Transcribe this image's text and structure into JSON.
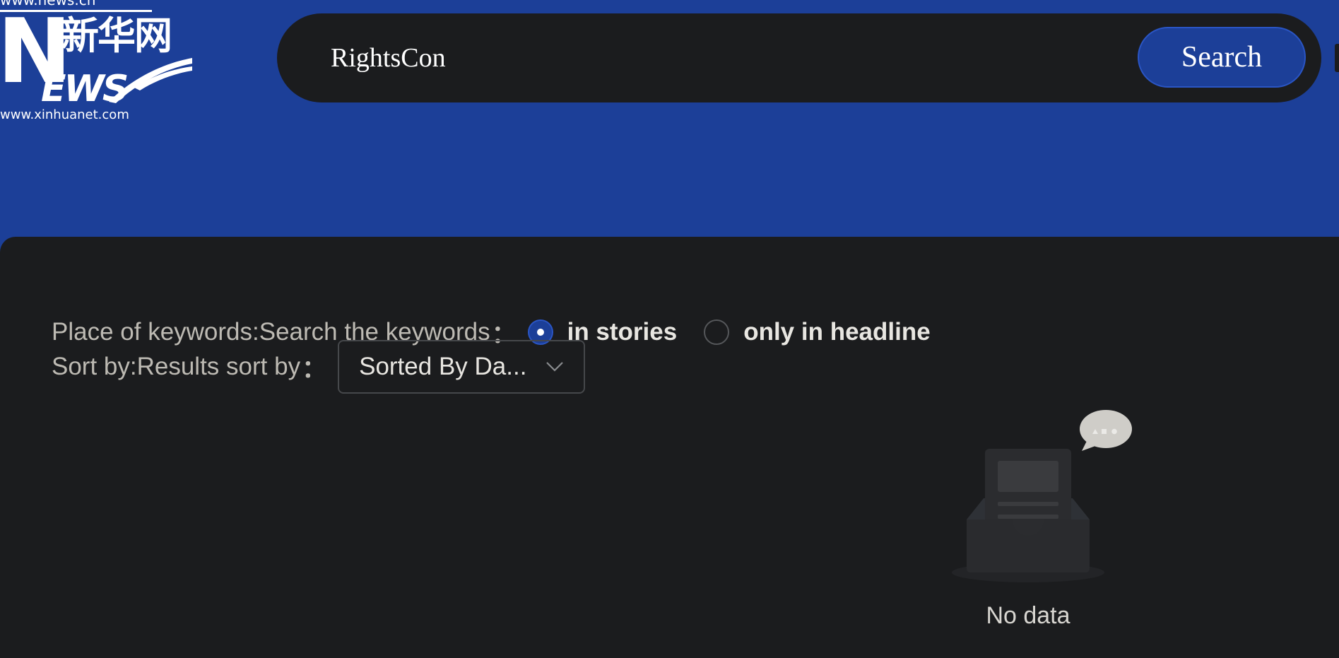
{
  "logo": {
    "url_top": "www.news.cn",
    "letter_n": "N",
    "chinese": "新华网",
    "letters_ews": "EWS",
    "url_bottom": "www.xinhuanet.com"
  },
  "search": {
    "query": "RightsCon",
    "button_label": "Search"
  },
  "filters": {
    "keywords_label": "Place of keywords:Search the keywords",
    "colon": "：",
    "options": [
      {
        "label": "in stories",
        "checked": true
      },
      {
        "label": "only in headline",
        "checked": false
      }
    ],
    "sort_label": "Sort by:Results sort by",
    "sort_value": "Sorted By Da..."
  },
  "empty_state": {
    "text": "No data"
  },
  "colors": {
    "header_blue": "#1c3f98",
    "dark_bg": "#1b1c1e"
  }
}
